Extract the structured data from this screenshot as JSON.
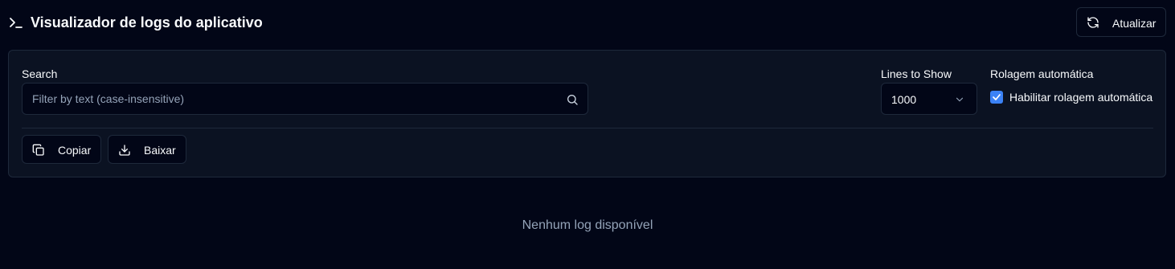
{
  "header": {
    "title": "Visualizador de logs do aplicativo",
    "title_icon": "terminal-icon",
    "refresh_label": "Atualizar",
    "refresh_icon": "refresh-icon"
  },
  "filters": {
    "search_label": "Search",
    "search_placeholder": "Filter by text (case-insensitive)",
    "search_value": "",
    "search_icon": "search-icon",
    "lines_label": "Lines to Show",
    "lines_value": "1000",
    "lines_icon": "chevron-down-icon",
    "autoscroll_label": "Rolagem automática",
    "autoscroll_checkbox_label": "Habilitar rolagem automática",
    "autoscroll_checked": true
  },
  "actions": {
    "copy_label": "Copiar",
    "copy_icon": "copy-icon",
    "download_label": "Baixar",
    "download_icon": "download-icon"
  },
  "log": {
    "empty_message": "Nenhum log disponível"
  },
  "colors": {
    "background": "#020617",
    "panel": "#0b1222",
    "border": "#1e293b",
    "accent": "#3b82f6",
    "muted_text": "#94a3b8"
  }
}
